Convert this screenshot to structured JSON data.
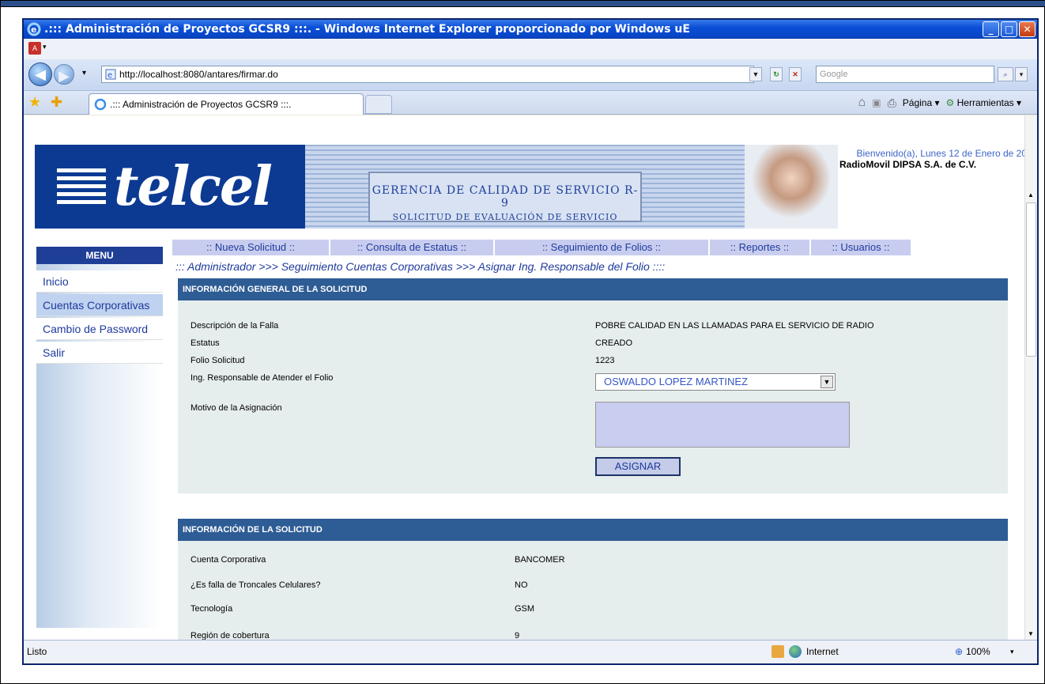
{
  "browser": {
    "title": ".::: Administración de Proyectos GCSR9 :::. - Windows Internet Explorer proporcionado por Windows uE",
    "url": "http://localhost:8080/antares/firmar.do",
    "search_placeholder": "Google",
    "tab_title": ".::: Administración de Proyectos GCSR9 :::.",
    "tools": {
      "page": "Página",
      "tools": "Herramientas"
    },
    "status": "Listo",
    "zone": "Internet",
    "zoom": "100%"
  },
  "banner": {
    "logo": "telcel",
    "title_line1": "GERENCIA DE CALIDAD DE SERVICIO R-9",
    "title_line2": "SOLICITUD DE EVALUACIÓN DE SERVICIO",
    "welcome": "Bienvenido(a), Lunes 12 de Enero de 20",
    "company": "RadioMovil DIPSA S.A. de C.V."
  },
  "sidebar": {
    "header": "MENU",
    "items": [
      {
        "label": "Inicio"
      },
      {
        "label": "Cuentas Corporativas"
      },
      {
        "label": "Cambio de Password"
      },
      {
        "label": "Salir"
      }
    ]
  },
  "nav": {
    "tabs": [
      {
        "label": ":: Nueva Solicitud ::"
      },
      {
        "label": ":: Consulta de Estatus ::"
      },
      {
        "label": ":: Seguimiento de Folios ::"
      },
      {
        "label": ":: Reportes ::"
      },
      {
        "label": ":: Usuarios ::"
      }
    ]
  },
  "breadcrumb": "::: Administrador >>> Seguimiento Cuentas Corporativas >>> Asignar Ing. Responsable del Folio ::::",
  "general": {
    "header": "INFORMACIÓN GENERAL DE LA SOLICITUD",
    "desc_label": "Descripción de la Falla",
    "desc_value": "POBRE CALIDAD EN LAS LLAMADAS PARA EL SERVICIO DE RADIO",
    "status_label": "Estatus",
    "status_value": "CREADO",
    "folio_label": "Folio Solicitud",
    "folio_value": "1223",
    "ing_label": "Ing. Responsable de Atender el Folio",
    "ing_value": "OSWALDO LOPEZ MARTINEZ",
    "motivo_label": "Motivo de la Asignación",
    "assign_button": "ASIGNAR"
  },
  "info": {
    "header": "INFORMACIÓN DE LA SOLICITUD",
    "rows": [
      {
        "label": "Cuenta Corporativa",
        "value": "BANCOMER"
      },
      {
        "label": "¿Es falla de Troncales Celulares?",
        "value": "NO"
      },
      {
        "label": "Tecnología",
        "value": "GSM"
      },
      {
        "label": "Región de cobertura",
        "value": "9"
      }
    ]
  }
}
